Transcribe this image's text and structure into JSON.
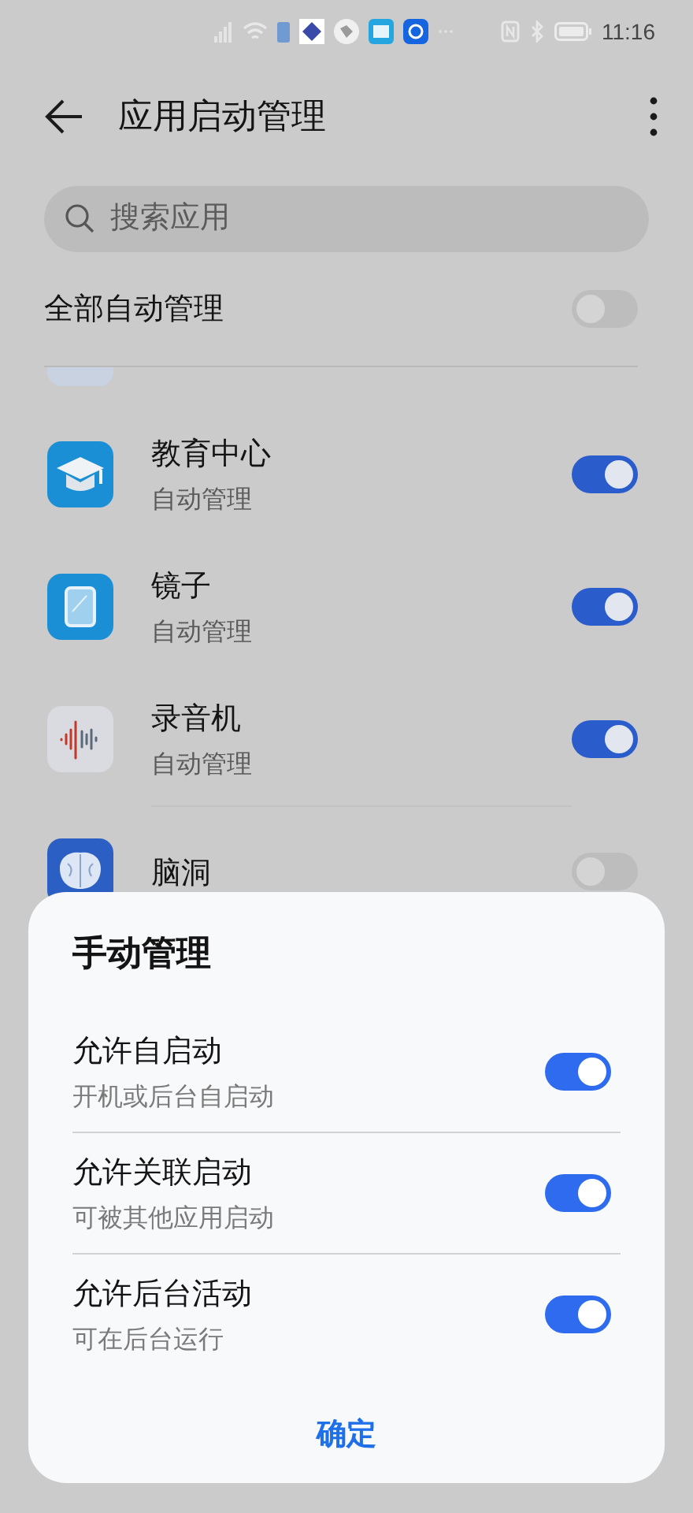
{
  "status_bar": {
    "time": "11:16"
  },
  "header": {
    "title": "应用启动管理"
  },
  "search": {
    "placeholder": "搜索应用"
  },
  "manage_all": {
    "label": "全部自动管理",
    "on": false
  },
  "apps": [
    {
      "name": "教育中心",
      "mode": "自动管理",
      "on": true,
      "kind": "education"
    },
    {
      "name": "镜子",
      "mode": "自动管理",
      "on": true,
      "kind": "mirror"
    },
    {
      "name": "录音机",
      "mode": "自动管理",
      "on": true,
      "kind": "recorder"
    },
    {
      "name": "脑洞",
      "on": false,
      "kind": "brain"
    }
  ],
  "dialog": {
    "title": "手动管理",
    "options": [
      {
        "label": "允许自启动",
        "description": "开机或后台自启动",
        "on": true
      },
      {
        "label": "允许关联启动",
        "description": "可被其他应用启动",
        "on": true
      },
      {
        "label": "允许后台活动",
        "description": "可在后台运行",
        "on": true
      }
    ],
    "confirm": "确定"
  }
}
